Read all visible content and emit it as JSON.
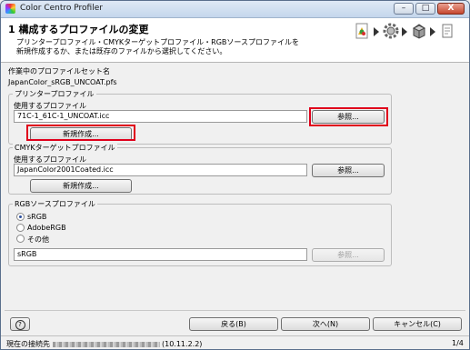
{
  "window": {
    "title": "Color Centro Profiler",
    "minimize": "–",
    "maximize": "□",
    "close": "X"
  },
  "header": {
    "title": "1 構成するプロファイルの変更",
    "description_line1": "プリンタープロファイル・CMYKターゲットプロファイル・RGBソースプロファイルを",
    "description_line2": "新規作成するか、または既存のファイルから選択してください。"
  },
  "profile_set": {
    "label": "作業中のプロファイルセット名",
    "value": "JapanColor_sRGB_UNCOAT.pfs"
  },
  "printer_profile": {
    "group_label": "プリンタープロファイル",
    "use_label": "使用するプロファイル",
    "value": "71C-1_61C-1_UNCOAT.icc",
    "browse": "参照...",
    "new": "新規作成..."
  },
  "cmyk_profile": {
    "group_label": "CMYKターゲットプロファイル",
    "use_label": "使用するプロファイル",
    "value": "JapanColor2001Coated.icc",
    "browse": "参照...",
    "new": "新規作成..."
  },
  "rgb_profile": {
    "group_label": "RGBソースプロファイル",
    "options": [
      "sRGB",
      "AdobeRGB",
      "その他"
    ],
    "selected": "sRGB",
    "value": "sRGB",
    "browse": "参照..."
  },
  "footer": {
    "help": "?",
    "back": "戻る(B)",
    "next": "次へ(N)",
    "cancel": "キャンセル(C)"
  },
  "status": {
    "label": "現在の接続先",
    "ip": "(10.11.2.2)",
    "page": "1/4"
  }
}
